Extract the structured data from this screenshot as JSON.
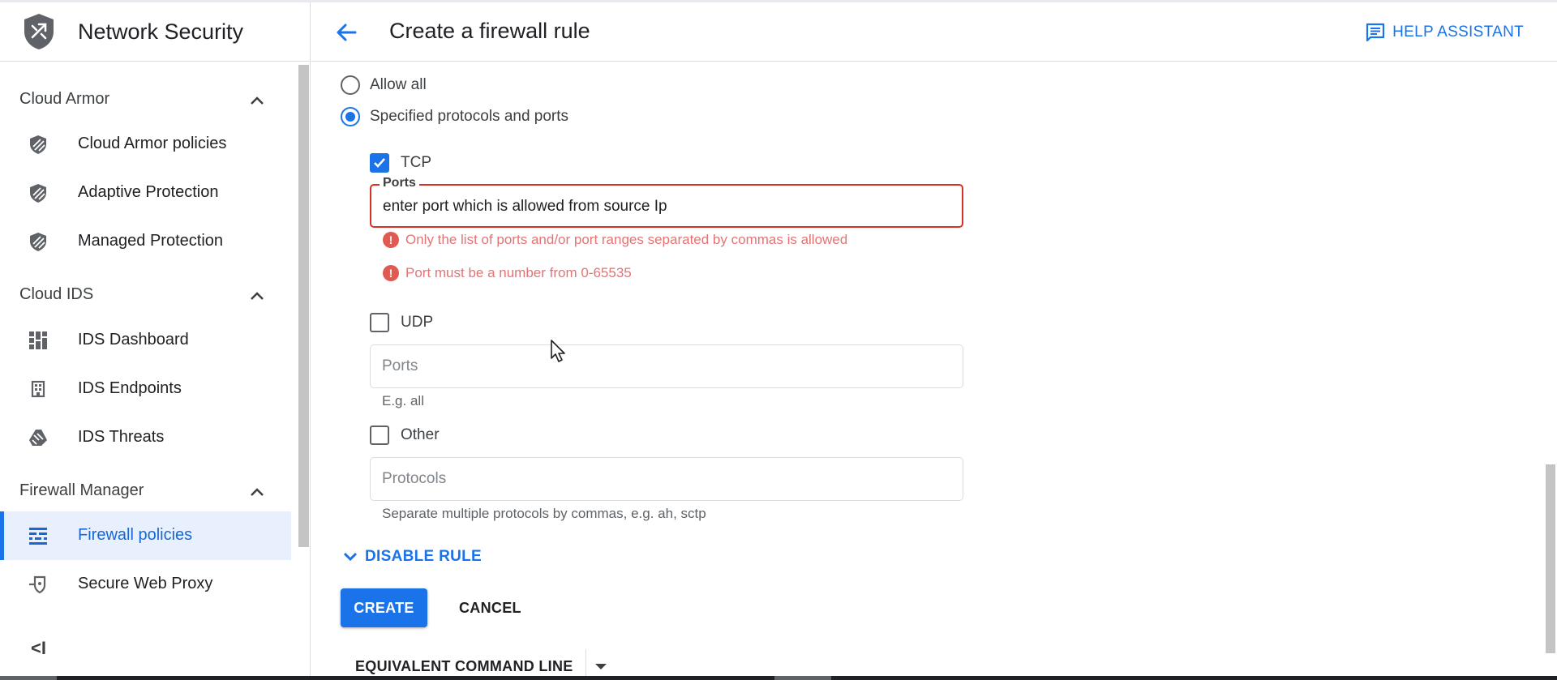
{
  "sidebar": {
    "title": "Network Security",
    "sections": [
      {
        "title": "Cloud Armor",
        "items": [
          {
            "label": "Cloud Armor policies",
            "icon": "shield-icon"
          },
          {
            "label": "Adaptive Protection",
            "icon": "shield-icon"
          },
          {
            "label": "Managed Protection",
            "icon": "shield-icon"
          }
        ]
      },
      {
        "title": "Cloud IDS",
        "items": [
          {
            "label": "IDS Dashboard",
            "icon": "dashboard-icon"
          },
          {
            "label": "IDS Endpoints",
            "icon": "endpoint-icon"
          },
          {
            "label": "IDS Threats",
            "icon": "threats-icon"
          }
        ]
      },
      {
        "title": "Firewall Manager",
        "items": [
          {
            "label": "Firewall policies",
            "icon": "firewall-icon",
            "active": true
          },
          {
            "label": "Secure Web Proxy",
            "icon": "proxy-icon"
          }
        ]
      }
    ],
    "collapse_label": "<I"
  },
  "header": {
    "title": "Create a firewall rule",
    "help_label": "HELP ASSISTANT"
  },
  "form": {
    "protocols": {
      "allow_all_label": "Allow all",
      "allow_all_selected": false,
      "specified_label": "Specified protocols and ports",
      "specified_selected": true
    },
    "tcp": {
      "label": "TCP",
      "checked": true,
      "ports_label": "Ports",
      "ports_value": "enter port which is allowed from source Ip",
      "errors": [
        "Only the list of ports and/or port ranges separated by commas is allowed",
        "Port must be a number from 0-65535"
      ]
    },
    "udp": {
      "label": "UDP",
      "checked": false,
      "ports_placeholder": "Ports",
      "hint": "E.g. all"
    },
    "other": {
      "label": "Other",
      "checked": false,
      "protocols_placeholder": "Protocols",
      "hint": "Separate multiple protocols by commas, e.g. ah, sctp"
    },
    "disable_rule_label": "DISABLE RULE",
    "create_label": "CREATE",
    "cancel_label": "CANCEL",
    "equivalent_cmd_label": "EQUIVALENT COMMAND LINE"
  },
  "colors": {
    "accent": "#1a73e8",
    "error": "#d93025",
    "active_bg": "#e8f0fe"
  }
}
